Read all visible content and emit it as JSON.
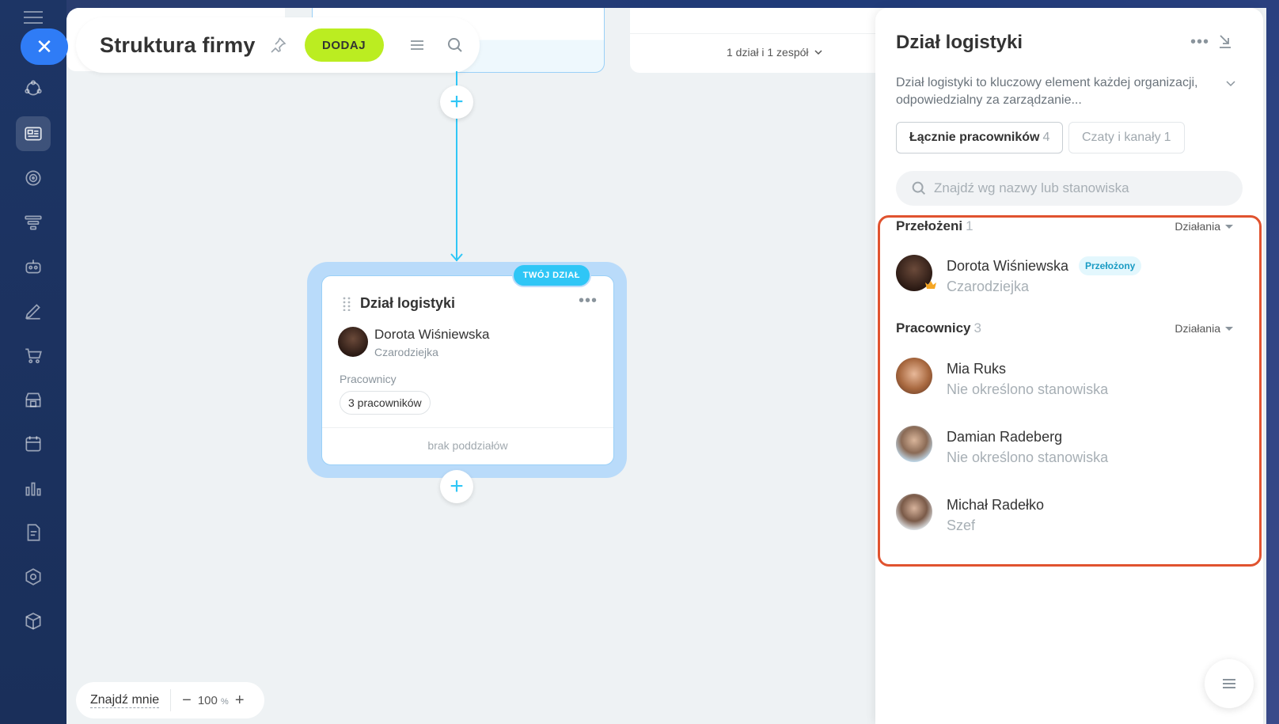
{
  "header": {
    "title": "Struktura firmy",
    "add_label": "DODAJ"
  },
  "top_card": {
    "summary": "1 dział i 1 zespół"
  },
  "dept_card": {
    "badge": "TWÓJ DZIAŁ",
    "title": "Dział logistyki",
    "head_name": "Dorota Wiśniewska",
    "head_role": "Czarodziejka",
    "staff_label": "Pracownicy",
    "staff_count": "3 pracowników",
    "subdepts": "brak poddziałów"
  },
  "bottom_bar": {
    "find_me": "Znajdź mnie",
    "zoom_value": "100",
    "zoom_unit": "%"
  },
  "panel": {
    "title": "Dział logistyki",
    "description": "Dział logistyki to kluczowy element każdej organizacji, odpowiedzialny za zarządzanie...",
    "tabs": [
      {
        "label": "Łącznie pracowników",
        "count": "4"
      },
      {
        "label": "Czaty i kanały",
        "count": "1"
      }
    ],
    "search_placeholder": "Znajdź wg nazwy lub stanowiska",
    "sections": {
      "heads": {
        "title": "Przełożeni",
        "count": "1",
        "actions": "Działania",
        "people": [
          {
            "name": "Dorota Wiśniewska",
            "role": "Czarodziejka",
            "badge": "Przełożony"
          }
        ]
      },
      "staff": {
        "title": "Pracownicy",
        "count": "3",
        "actions": "Działania",
        "people": [
          {
            "name": "Mia Ruks",
            "role": "Nie określono stanowiska"
          },
          {
            "name": "Damian Radeberg",
            "role": "Nie określono stanowiska"
          },
          {
            "name": "Michał Radełko",
            "role": "Szef"
          }
        ]
      }
    }
  },
  "colors": {
    "accent_blue": "#2fc6f6",
    "add_green": "#bbed21",
    "highlight": "#e0532f",
    "close_blue": "#2f7cf6"
  }
}
